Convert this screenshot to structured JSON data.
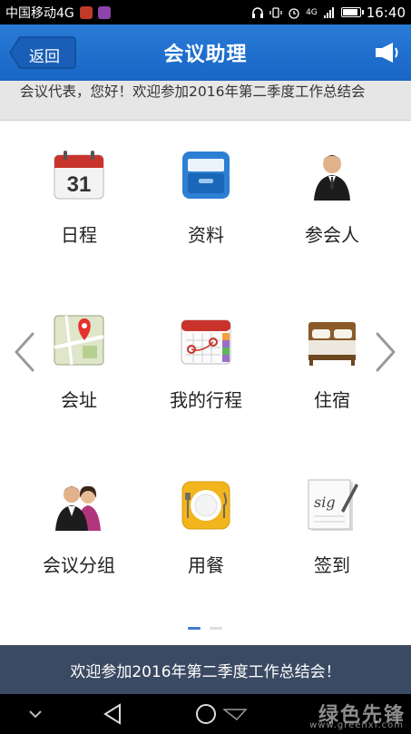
{
  "status_bar": {
    "carrier": "中国移动4G",
    "network": "4G",
    "time": "16:40",
    "icons": [
      "app-notification-icon",
      "app-notification-icon",
      "headphones-icon",
      "vibrate-icon",
      "alarm-icon",
      "signal-icon",
      "battery-icon"
    ]
  },
  "header": {
    "back_label": "返回",
    "title": "会议助理",
    "announce_icon": "megaphone-icon"
  },
  "marquee": {
    "text": "会议代表，您好！欢迎参加2016年第二季度工作总结会"
  },
  "grid": {
    "items": [
      {
        "label": "日程",
        "icon": "calendar-icon"
      },
      {
        "label": "资料",
        "icon": "file-cabinet-icon"
      },
      {
        "label": "参会人",
        "icon": "person-icon"
      },
      {
        "label": "会址",
        "icon": "map-pin-icon"
      },
      {
        "label": "我的行程",
        "icon": "itinerary-calendar-icon"
      },
      {
        "label": "住宿",
        "icon": "bed-icon"
      },
      {
        "label": "会议分组",
        "icon": "group-icon"
      },
      {
        "label": "用餐",
        "icon": "dining-plate-icon"
      },
      {
        "label": "签到",
        "icon": "signature-icon"
      }
    ],
    "calendar_day": "31",
    "signature_text": "sig",
    "pager": {
      "pages": 2,
      "current": 1
    }
  },
  "footer": {
    "ticker": "欢迎参加2016年第二季度工作总结会！"
  },
  "watermark": {
    "brand": "绿色先锋",
    "url": "www.greenxf.com"
  },
  "colors": {
    "header_blue": "#1865c4",
    "footer_bg": "#3b4a63",
    "marquee_bg": "#e6e6e6",
    "pager_active": "#3d7bd0"
  }
}
